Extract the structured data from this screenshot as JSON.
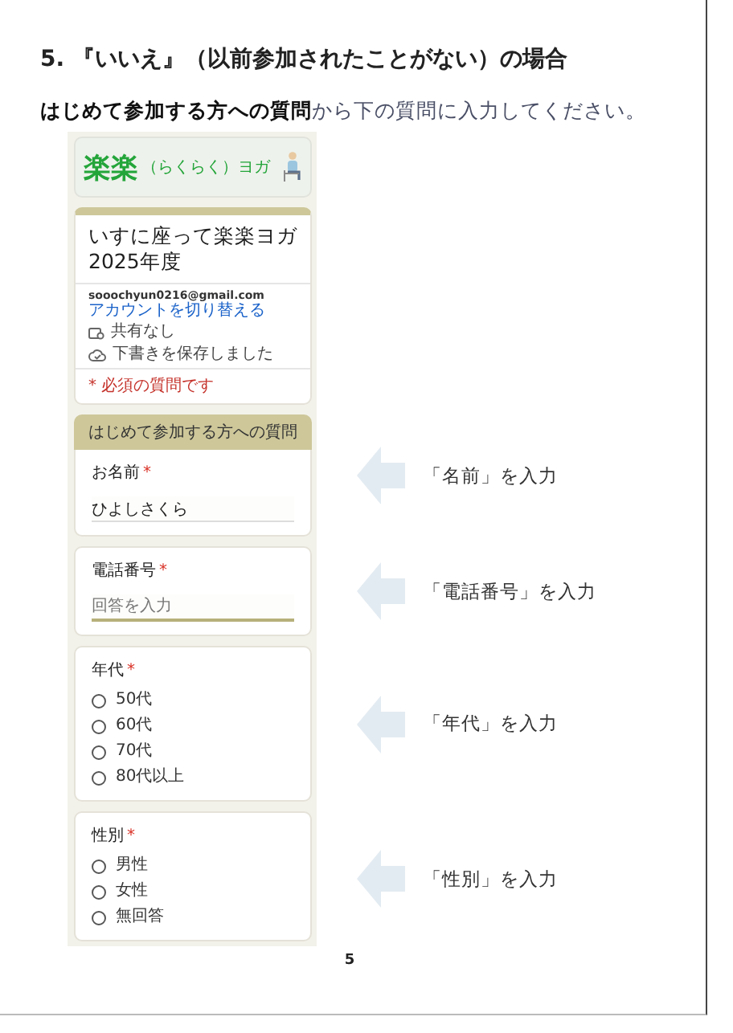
{
  "heading": "5. 『いいえ』（以前参加されたことがない）の場合",
  "instruction": "**はじめて参加する方への質問**から下の質問に入力してください。",
  "form": {
    "logo": {
      "title": "楽楽",
      "subtitle": "（らくらく）ヨガ"
    },
    "title_lines": [
      "いすに座って楽楽ヨガ",
      "2025年度"
    ],
    "email": "sooochyun0216@gmail.com",
    "switch_account": "アカウントを切り替える",
    "sharing": "共有なし",
    "draft_status": "下書きを保存しました",
    "required_note": "* 必須の質問です",
    "section_title": "はじめて参加する方への質問",
    "questions": [
      {
        "kind": "text",
        "label": "お名前",
        "required_mark": "*",
        "value": "ひよしさくら",
        "focused": false,
        "callout": "「名前」を入力"
      },
      {
        "kind": "text",
        "label": "電話番号",
        "required_mark": "*",
        "placeholder": "回答を入力",
        "focused": true,
        "callout": "「電話番号」を入力"
      },
      {
        "kind": "radio",
        "label": "年代",
        "required_mark": "*",
        "callout": "「年代」を入力",
        "options": [
          {
            "label": "50代",
            "selected": false
          },
          {
            "label": "60代",
            "selected": false
          },
          {
            "label": "70代",
            "selected": false
          },
          {
            "label": "80代以上",
            "selected": false
          }
        ]
      },
      {
        "kind": "radio",
        "label": "性別",
        "required_mark": "*",
        "callout": "「性別」を入力",
        "options": [
          {
            "label": "男性",
            "selected": false
          },
          {
            "label": "女性",
            "selected": false
          },
          {
            "label": "無回答",
            "selected": false
          }
        ]
      }
    ]
  },
  "page_number": "5"
}
